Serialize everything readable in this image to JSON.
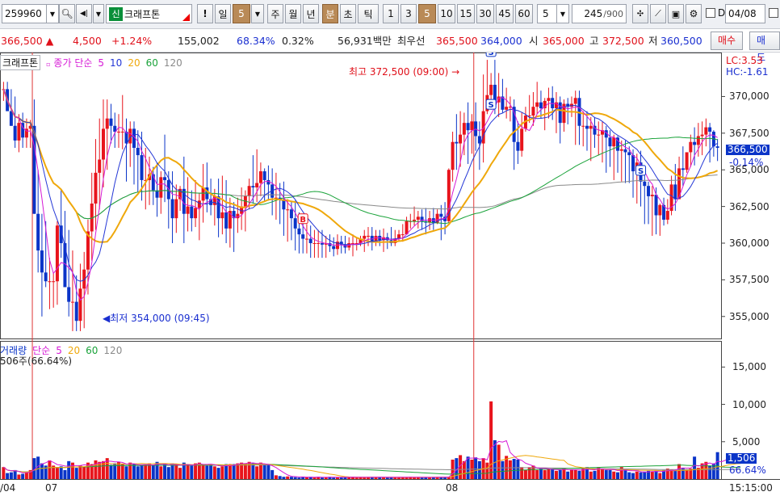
{
  "toolbar": {
    "code": "259960",
    "new_badge": "신",
    "stock_name": "크래프톤",
    "alert_label": "!",
    "period_day": "일",
    "period_value": "5",
    "period_week": "주",
    "period_month": "월",
    "period_year": "년",
    "period_minute": "분",
    "period_second": "초",
    "period_tick": "틱",
    "intervals": [
      "1",
      "3",
      "5",
      "10",
      "15",
      "30",
      "45",
      "60"
    ],
    "interval_input": "5",
    "count_value": "245",
    "count_total": "/900",
    "date_prefix": "D",
    "date_value": "04/08"
  },
  "quote": {
    "price": "366,500",
    "change": "4,500",
    "change_pct": "+1.24%",
    "volume": "155,002",
    "ratio1": "68.34%",
    "ratio2": "0.32%",
    "amount": "56,931백만",
    "priority_label": "최우선",
    "ask": "365,500",
    "bid": "364,000",
    "open_label": "시",
    "open": "365,000",
    "high_label": "고",
    "high": "372,500",
    "low_label": "저",
    "low": "360,500",
    "buy_label": "매수",
    "sell_label": "매도"
  },
  "price_panel": {
    "legend": {
      "name": "크래프톤",
      "series": "종가 단순",
      "ma5": "5",
      "ma10": "10",
      "ma20": "20",
      "ma60": "60",
      "ma120": "120"
    },
    "lc": "LC:3.53",
    "hc": "HC:-1.61",
    "current_price": "366,500",
    "current_pct": "-0.14%",
    "max_note": "최고 372,500 (09:00)",
    "min_note": "최저 354,000 (09:45)",
    "signal_sell": "S",
    "signal_buy": "B"
  },
  "volume_panel": {
    "legend": {
      "name": "거래량",
      "series": "단순",
      "ma5": "5",
      "ma20": "20",
      "ma60": "60",
      "ma120": "120"
    },
    "summary": "506주(66.64%)",
    "current_volume": "1,506",
    "current_pct": "66.64%"
  },
  "xaxis": {
    "labels": [
      "/04",
      "07",
      "08"
    ],
    "time": "15:15:00"
  },
  "chart_data": [
    {
      "type": "candlestick",
      "y_ticks": [
        "370,000",
        "367,500",
        "365,000",
        "362,500",
        "360,000",
        "357,500",
        "355,000"
      ],
      "ylim": [
        353500,
        373000
      ],
      "open": [
        370500,
        370500,
        369000,
        368000,
        367000,
        368200,
        367200,
        367800,
        368000,
        362000,
        359500,
        358000,
        357400,
        357400,
        357400,
        361200,
        360000,
        357000,
        356000,
        356000,
        354700,
        356900,
        358200,
        360800,
        362700,
        364800,
        365700,
        367800,
        368500,
        368000,
        367600,
        367600,
        367600,
        366800,
        367800,
        366500,
        366000,
        364300,
        364300,
        364700,
        363600,
        363100,
        364500,
        364300,
        363000,
        361700,
        363000,
        363700,
        362000,
        362500,
        361700,
        362400,
        362900,
        363800,
        363000,
        362600,
        363200,
        361700,
        362100,
        361000,
        362200,
        361700,
        362000,
        362500,
        363200,
        363900,
        363800,
        364100,
        364900,
        364300,
        364000,
        363100,
        363100,
        363000,
        362300,
        362300,
        361700,
        361000,
        360600,
        360300,
        360300,
        360000,
        360000,
        360000,
        359900,
        360000,
        359800,
        359600,
        360100,
        359900,
        359700,
        360000,
        360000,
        360000,
        360300,
        360500,
        360500,
        360100,
        360500,
        360200,
        360400,
        360200,
        360000,
        360300,
        360600,
        360600,
        361500,
        361500,
        361600,
        361800,
        361500,
        361400,
        361700,
        361400,
        362000,
        361800,
        361500,
        365000,
        366900,
        366800,
        367400,
        368200,
        367700,
        368300,
        367300,
        366800,
        369000,
        370100,
        370800,
        369600,
        370000,
        369100,
        369300,
        369300,
        366900,
        366300,
        367800,
        368700,
        368700,
        369300,
        369600,
        369200,
        369700,
        369900,
        369200,
        369600,
        368200,
        369500,
        369300,
        369500,
        369900,
        368000,
        368000,
        367800,
        368000,
        367400,
        367400,
        367700,
        367200,
        366600,
        367200,
        366300,
        366400,
        366200,
        366000,
        364900,
        365500,
        364200,
        363900,
        363200,
        363300,
        361900,
        362600,
        361600,
        362200,
        364000,
        363000,
        365100,
        365000,
        366200,
        366900,
        366700,
        367300,
        367400,
        367900,
        367600,
        366600
      ],
      "high": [
        371000,
        371000,
        370500,
        370000,
        368800,
        368900,
        368500,
        368400,
        369800,
        365000,
        362000,
        361500,
        359000,
        358000,
        361500,
        363700,
        362200,
        360900,
        359500,
        357800,
        358600,
        359400,
        361600,
        364800,
        367100,
        368500,
        369800,
        369800,
        369500,
        368900,
        368800,
        370100,
        368500,
        368300,
        368300,
        367700,
        367600,
        366500,
        365900,
        365200,
        365500,
        364900,
        367400,
        364900,
        364900,
        364000,
        363900,
        365900,
        364500,
        363600,
        364300,
        363400,
        365400,
        365500,
        364400,
        363700,
        364400,
        364600,
        364300,
        363100,
        362800,
        363100,
        363800,
        363600,
        364400,
        366000,
        366400,
        365500,
        365100,
        365300,
        365100,
        364800,
        364100,
        364200,
        363000,
        362900,
        362900,
        362100,
        361500,
        361300,
        361200,
        360900,
        360900,
        360900,
        360500,
        360600,
        360400,
        360600,
        360500,
        360500,
        360400,
        360600,
        360400,
        360500,
        360900,
        361100,
        361100,
        360900,
        360900,
        361000,
        360700,
        361100,
        360900,
        360900,
        361300,
        361800,
        362000,
        362500,
        362200,
        362300,
        362400,
        362200,
        362400,
        362300,
        362600,
        362800,
        365100,
        367600,
        368800,
        369000,
        368900,
        369600,
        368800,
        369600,
        368300,
        371500,
        372500,
        371600,
        372500,
        371600,
        371200,
        370600,
        370000,
        369800,
        368300,
        368900,
        369300,
        370100,
        370300,
        371000,
        370400,
        369900,
        370600,
        370700,
        370300,
        370000,
        369800,
        369900,
        370000,
        370400,
        370400,
        369000,
        369000,
        368600,
        368600,
        368300,
        368300,
        368000,
        367700,
        367400,
        367300,
        367000,
        367000,
        366600,
        366400,
        366100,
        366300,
        364700,
        364200,
        363900,
        363800,
        362700,
        363100,
        363000,
        364600,
        365400,
        365900,
        366600,
        365500,
        367400,
        367900,
        368200,
        368300,
        368500,
        368200,
        367700,
        367100
      ],
      "low": [
        369700,
        369500,
        368000,
        366500,
        366200,
        366500,
        366500,
        366500,
        362000,
        358000,
        355000,
        357000,
        355500,
        355600,
        355800,
        359000,
        357000,
        355000,
        354000,
        354000,
        354000,
        354200,
        356500,
        358800,
        360900,
        362300,
        363800,
        365000,
        366800,
        366500,
        366500,
        366400,
        364200,
        365200,
        364000,
        363500,
        362900,
        362300,
        362600,
        362600,
        361800,
        362000,
        362800,
        361000,
        360000,
        360700,
        362200,
        360000,
        360800,
        360800,
        361100,
        360200,
        361400,
        362100,
        361900,
        361200,
        360400,
        360600,
        360000,
        359700,
        359400,
        360700,
        360900,
        360800,
        362300,
        362700,
        362800,
        363200,
        362800,
        362900,
        361900,
        361600,
        361300,
        360500,
        360100,
        360200,
        359500,
        359300,
        359300,
        359300,
        359000,
        359000,
        359000,
        359000,
        359000,
        359400,
        359100,
        359200,
        359300,
        359300,
        359500,
        359100,
        359500,
        359800,
        359400,
        359800,
        359500,
        359800,
        359800,
        359400,
        359600,
        359800,
        359800,
        360100,
        360100,
        360900,
        361000,
        361200,
        361000,
        360900,
        360600,
        360900,
        360900,
        361300,
        360200,
        360600,
        361400,
        364200,
        365000,
        365200,
        366000,
        365400,
        366100,
        366300,
        365000,
        365500,
        368800,
        369100,
        368800,
        368600,
        368900,
        368500,
        368300,
        365000,
        365400,
        365900,
        367600,
        368200,
        368000,
        368800,
        368500,
        367700,
        368500,
        368400,
        367500,
        366800,
        367600,
        368100,
        368600,
        366700,
        366700,
        366600,
        366300,
        365600,
        366500,
        366000,
        365500,
        364800,
        365200,
        364300,
        364800,
        364200,
        364100,
        364100,
        363100,
        362700,
        362500,
        361300,
        361300,
        360500,
        360600,
        360500,
        361200,
        361300,
        361900,
        362200,
        363900,
        363900,
        364800,
        365200,
        365300,
        365900,
        366000,
        366600,
        365500,
        365900,
        365600
      ],
      "close": [
        370500,
        369000,
        368000,
        367000,
        368200,
        367200,
        367800,
        368000,
        362000,
        359500,
        358000,
        357400,
        357400,
        357400,
        361200,
        360000,
        357000,
        356000,
        356000,
        354700,
        356900,
        358200,
        360800,
        362700,
        364800,
        365700,
        367800,
        368500,
        368000,
        367600,
        367600,
        367600,
        366800,
        367800,
        366500,
        366000,
        364300,
        364300,
        364700,
        363600,
        363100,
        364500,
        364300,
        363000,
        361700,
        363000,
        363700,
        362000,
        362500,
        361700,
        362400,
        362900,
        363800,
        363000,
        362600,
        363200,
        361700,
        362100,
        361000,
        362200,
        361700,
        362000,
        362500,
        363200,
        363900,
        363800,
        364100,
        364900,
        364300,
        364000,
        363100,
        363100,
        363000,
        362300,
        362300,
        361700,
        361000,
        360600,
        360300,
        360300,
        360000,
        360000,
        360000,
        359900,
        360000,
        359800,
        359600,
        360100,
        359900,
        359700,
        360000,
        360000,
        360000,
        360300,
        360500,
        360500,
        360100,
        360500,
        360200,
        360400,
        360200,
        360000,
        360300,
        360600,
        360600,
        361500,
        361500,
        361600,
        361800,
        361500,
        361400,
        361700,
        361400,
        362000,
        361800,
        361500,
        365000,
        366900,
        366800,
        367400,
        368200,
        367700,
        368300,
        367300,
        366800,
        369000,
        370100,
        370800,
        369600,
        370000,
        369100,
        369300,
        369300,
        366900,
        366300,
        367800,
        368700,
        368700,
        369300,
        369600,
        369200,
        369700,
        369900,
        369200,
        369600,
        368200,
        369500,
        369300,
        369500,
        369900,
        368000,
        368000,
        367800,
        368000,
        367400,
        367400,
        367700,
        367200,
        366600,
        367200,
        366300,
        366400,
        366200,
        366000,
        364900,
        365500,
        364200,
        363900,
        363200,
        363300,
        361900,
        362600,
        361600,
        362200,
        364000,
        363000,
        365100,
        365000,
        366200,
        366900,
        366700,
        367300,
        367400,
        367900,
        367600,
        366600,
        366500
      ],
      "volume": [
        1600,
        800,
        900,
        1200,
        600,
        700,
        900,
        1200,
        2800,
        3000,
        2100,
        1800,
        2500,
        1800,
        1500,
        1700,
        1200,
        2400,
        2200,
        1500,
        1800,
        1600,
        2200,
        2000,
        2500,
        2300,
        2400,
        2800,
        1900,
        2100,
        2300,
        2000,
        1700,
        2200,
        2000,
        1700,
        1900,
        1900,
        2100,
        1800,
        2300,
        1700,
        2100,
        1600,
        2100,
        2000,
        1500,
        2200,
        1900,
        1800,
        2100,
        2200,
        1900,
        1800,
        2000,
        1700,
        1500,
        1700,
        2000,
        2000,
        2000,
        2100,
        2200,
        2100,
        2300,
        2100,
        1700,
        2200,
        1900,
        1900,
        1200,
        500,
        400,
        300,
        350,
        300,
        250,
        200,
        300,
        250,
        300,
        220,
        280,
        200,
        250,
        300,
        200,
        250,
        220,
        280,
        300,
        250,
        200,
        220,
        250,
        280,
        300,
        250,
        220,
        230,
        260,
        280,
        250,
        200,
        220,
        240,
        300,
        250,
        220,
        200,
        230,
        250,
        280,
        300,
        250,
        220,
        240,
        2600,
        2800,
        3200,
        2400,
        3000,
        2600,
        2900,
        2400,
        2800,
        2200,
        10400,
        5200,
        4600,
        2400,
        3100,
        2500,
        2700,
        2600,
        1600,
        1200,
        1600,
        1800,
        1200,
        1400,
        1200,
        1300,
        1400,
        1100,
        1200,
        1500,
        1000,
        1300,
        1200,
        1100,
        1400,
        1600,
        1000,
        1100,
        1600,
        1400,
        1200,
        1200,
        1000,
        900,
        1600,
        1300,
        900,
        800,
        1000,
        900,
        1000,
        1100,
        1000,
        1100,
        800,
        1200,
        1400,
        1300,
        1200,
        2000,
        1500,
        1300,
        1400,
        3000,
        1500,
        2100,
        2300,
        1800,
        2100,
        3600,
        1800,
        3200,
        3500,
        2600,
        2300,
        1506
      ],
      "x_markers": [
        "07",
        "08"
      ]
    }
  ],
  "colors": {
    "up": "#e8141c",
    "down": "#0a34c8",
    "ma5": "#d61ad6",
    "ma10": "#2437d6",
    "ma20": "#efa80b",
    "ma60": "#1aa33a",
    "ma120": "#8a8a8a",
    "day_line": "#e03535"
  }
}
